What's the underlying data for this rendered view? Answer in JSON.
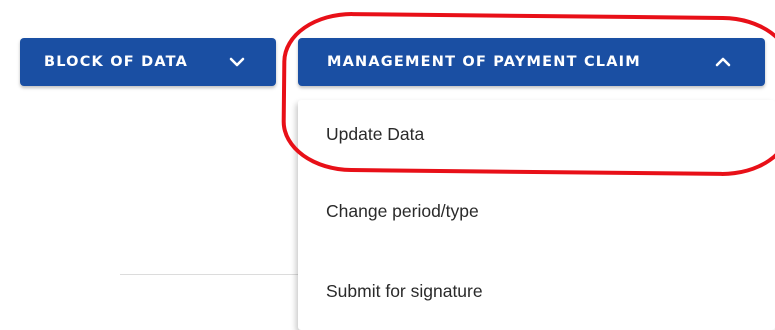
{
  "toolbar": {
    "block_of_data_label": "BLOCK OF DATA",
    "management_label": "MANAGEMENT OF PAYMENT CLAIM"
  },
  "menu": {
    "items": [
      {
        "label": "Update Data"
      },
      {
        "label": "Change period/type"
      },
      {
        "label": "Submit for signature"
      }
    ]
  },
  "icons": {
    "block_of_data_chevron": "chevron-down-icon",
    "management_chevron": "chevron-up-icon"
  },
  "colors": {
    "button_bg": "#1a4fa3",
    "button_text": "#ffffff",
    "highlight": "#e81018",
    "menu_text": "#2a2a2a"
  }
}
